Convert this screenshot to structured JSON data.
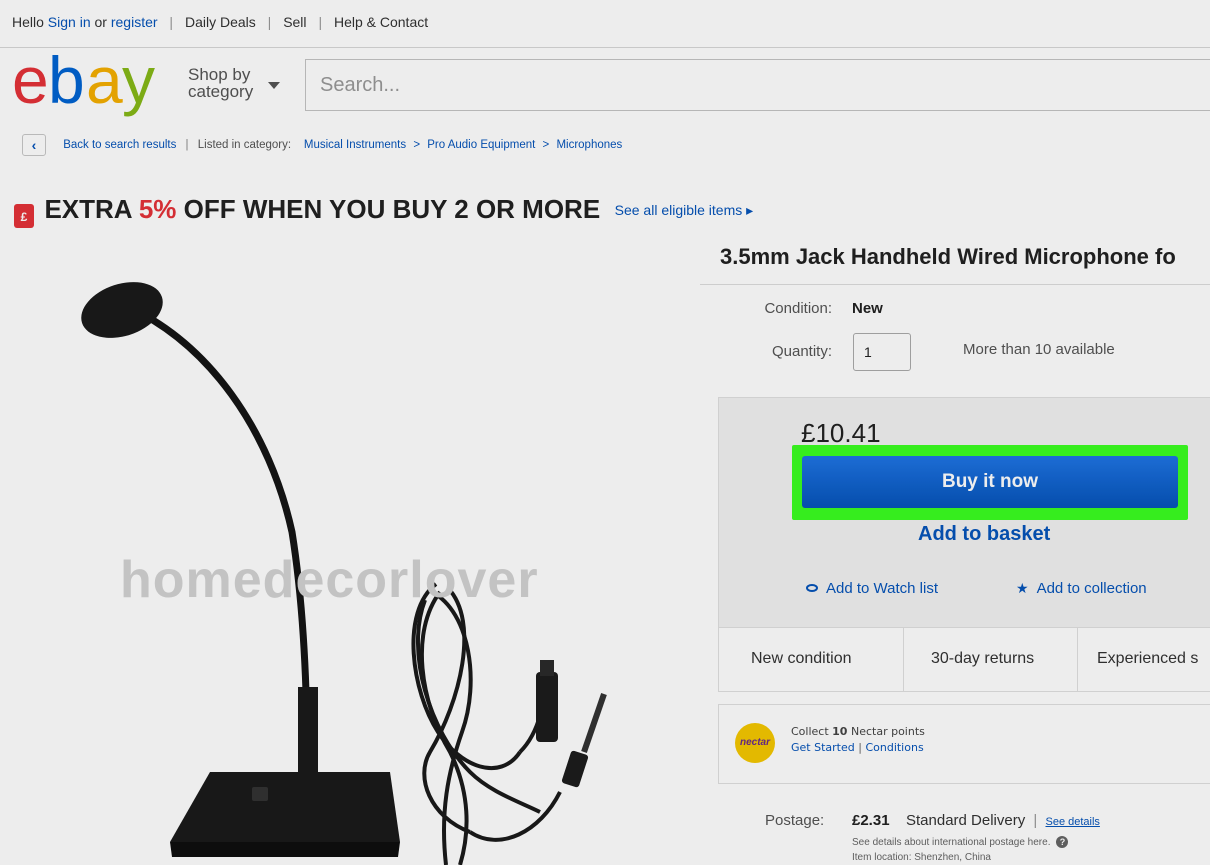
{
  "topbar": {
    "hello": "Hello",
    "sign_in": "Sign in",
    "or": "or",
    "register": "register",
    "daily_deals": "Daily Deals",
    "sell": "Sell",
    "help": "Help & Contact"
  },
  "header": {
    "logo": {
      "e": "e",
      "b": "b",
      "a": "a",
      "y": "y"
    },
    "shop_by_line1": "Shop by",
    "shop_by_line2": "category",
    "search_placeholder": "Search..."
  },
  "breadcrumb": {
    "back": "Back to search results",
    "listed_in": "Listed in category:",
    "cat1": "Musical Instruments",
    "cat2": "Pro Audio Equipment",
    "cat3": "Microphones",
    "arrow": ">"
  },
  "promo": {
    "text_before": "EXTRA ",
    "percent": "5%",
    "text_after": " OFF WHEN YOU BUY 2 OR MORE",
    "eligible_link": "See all eligible items ▸"
  },
  "product": {
    "watermark": "homedecorlover",
    "title": "3.5mm Jack Handheld Wired Microphone fo",
    "condition_label": "Condition:",
    "condition_value": "New",
    "quantity_label": "Quantity:",
    "quantity_value": "1",
    "availability": "More than 10 available",
    "price": "£10.41",
    "buy_now": "Buy it now",
    "add_to_basket": "Add to basket",
    "add_watch": "Add to Watch list",
    "add_collection": "Add to collection"
  },
  "features": [
    "New condition",
    "30-day returns",
    "Experienced s"
  ],
  "nectar": {
    "logo": "nectar",
    "collect_pre": "Collect ",
    "points": "10",
    "collect_post": " Nectar points",
    "get_started": "Get Started",
    "sep": "|",
    "conditions": "Conditions"
  },
  "postage": {
    "label": "Postage:",
    "price": "£2.31",
    "type": "Standard Delivery",
    "sep": "|",
    "details_link": "See details",
    "note": "See details about international postage here.",
    "location": "Item location:  Shenzhen, China"
  },
  "colors": {
    "ebay_red": "#e53238",
    "ebay_blue": "#0064d2",
    "ebay_yellow": "#f5af02",
    "ebay_green": "#86b817",
    "link_blue": "#0654ba",
    "highlight_green": "#3bff21"
  }
}
